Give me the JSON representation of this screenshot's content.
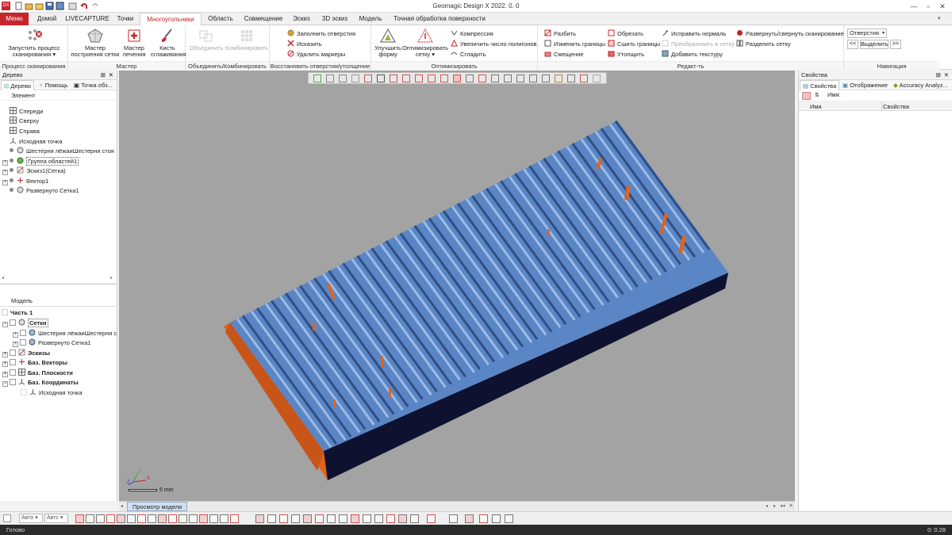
{
  "app": {
    "title": "Geomagic Design X 2022. 0. 0"
  },
  "tabs": [
    "Меню",
    "Домой",
    "LIVECAPTURE",
    "Точки",
    "Многоугольники",
    "Область",
    "Совмещение",
    "Эскиз",
    "3D эскиз",
    "Модель",
    "Точная обработка поверхности"
  ],
  "active_tab": "Многоугольники",
  "ribbon": {
    "scan_group": {
      "label": "Процесс сканирования",
      "btn_line1": "Запустить процесс",
      "btn_line2": "сканирования"
    },
    "wizard_group": {
      "label": "Мастер",
      "b1_l1": "Мастер",
      "b1_l2": "построения сетки",
      "b2_l1": "Мастер",
      "b2_l2": "лечения",
      "b3_l1": "Кисть",
      "b3_l2": "сглаживания"
    },
    "combine_group": {
      "label": "Объединить/Комбинировать",
      "b1": "Объединить",
      "b2": "Комбинировать"
    },
    "holes_group": {
      "label": "Восстановить отверстия/утолщение",
      "fill": "Заполнить отверстия",
      "distort": "Исказить",
      "remove_markers": "Удалить маркеры"
    },
    "optimize_group": {
      "label": "Оптимизировать",
      "improve_l1": "Улучшить",
      "improve_l2": "форму",
      "opt_l1": "Оптимизировать",
      "opt_l2": "сетку",
      "compress": "Компрессия",
      "increase": "Увеличить число полигонов",
      "smooth": "Сгладить"
    },
    "edit_group": {
      "label": "Редакт-ть",
      "split": "Разбить",
      "change_bounds": "Изменить границы",
      "offset": "Смещение",
      "trim": "Обрезать",
      "stitch": "Сшить границы",
      "thicken": "Утолщить",
      "fix_normals": "Исправить нормаль",
      "convert_mesh": "Преобразовать в сетку",
      "add_texture": "Добавить текстуру",
      "expand_scan": "Развернуть/свернуть сканирование",
      "split_mesh": "Разделить сетку"
    },
    "nav_group": {
      "label": "Навигация",
      "select_value": "Отверстия",
      "prev": "<<",
      "select": "Выделить",
      "next": ">>"
    }
  },
  "tree_panel": {
    "title": "Дерево",
    "subtabs": [
      "Дерево",
      "Помощь",
      "Точка обз..."
    ],
    "header": "Элемент",
    "items": [
      "Спереди",
      "Сверху",
      "Справа",
      "Исходная точка",
      "Шестерня лёжаиШестерня стоя",
      "Группа областей1",
      "Эскиз1(Сетка)",
      "Вектор1",
      "Развернуто Сетка1"
    ]
  },
  "model_panel": {
    "header": "Модель",
    "part": "Часть 1",
    "items": [
      "Сетки",
      "Шестерня лёжаиШестерня с",
      "Развернуто Сетка1",
      "Эскизы",
      "Баз. Векторы",
      "Баз. Плоскости",
      "Баз. Координаты",
      "Исходная точка"
    ]
  },
  "props_panel": {
    "title": "Свойства",
    "subtabs": [
      "Свойства",
      "Отображение",
      "Accuracy Analyz..."
    ],
    "name_label": "Имя:",
    "col_name": "Имя",
    "col_props": "Свойства"
  },
  "viewport": {
    "scale_label": "5 mm",
    "view_tab": "Просмотр модели",
    "axis_x": "X",
    "axis_y": "Y",
    "axis_z": "Z"
  },
  "bottom": {
    "combo1": "Авто",
    "combo2": "Автс"
  },
  "status": {
    "left": "Готово",
    "right": "0: 0.28"
  },
  "colors": {
    "accent": "#c8242b",
    "mesh_blue": "#5b86c5",
    "orange": "#e0641e",
    "dark": "#0e1230",
    "viewport_bg": "#a3a3a3"
  }
}
